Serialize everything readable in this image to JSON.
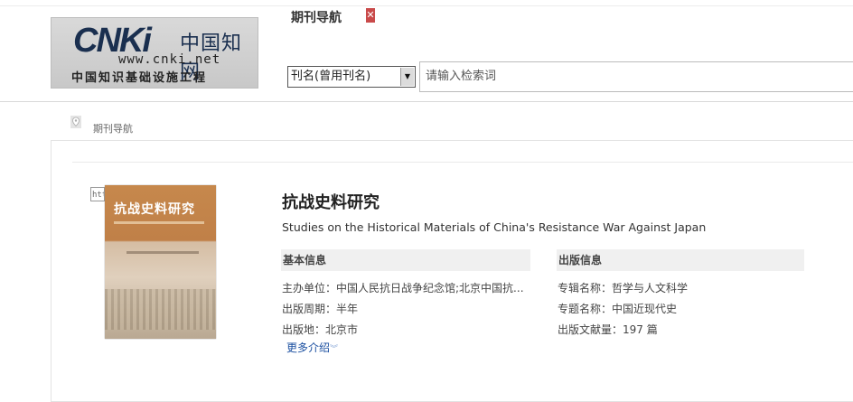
{
  "header": {
    "logo": {
      "mark": "CNKi",
      "cn": "中国知网",
      "url": "www.cnki.net",
      "tagline": "中国知识基础设施工程"
    },
    "nav_title": "期刊导航",
    "search": {
      "select_value": "刊名(曾用刊名)",
      "input_placeholder": "请输入检索词"
    }
  },
  "breadcrumb": "期刊导航",
  "journal": {
    "broken_image_alt": "htt",
    "cover_title": "抗战史料研究",
    "title": "抗战史料研究",
    "title_en": "Studies on the Historical Materials of China's Resistance War Against Japan",
    "basic_info": {
      "heading": "基本信息",
      "rows": [
        {
          "label": "主办单位：",
          "value": "中国人民抗日战争纪念馆;北京中国抗..."
        },
        {
          "label": "出版周期：",
          "value": "半年"
        },
        {
          "label": "出版地：",
          "value": "北京市"
        }
      ]
    },
    "publish_info": {
      "heading": "出版信息",
      "rows": [
        {
          "label": "专辑名称：",
          "value": "哲学与人文科学"
        },
        {
          "label": "专题名称：",
          "value": "中国近现代史"
        },
        {
          "label": "出版文献量：",
          "value": "197 篇"
        }
      ]
    },
    "more_label": "更多介绍"
  }
}
